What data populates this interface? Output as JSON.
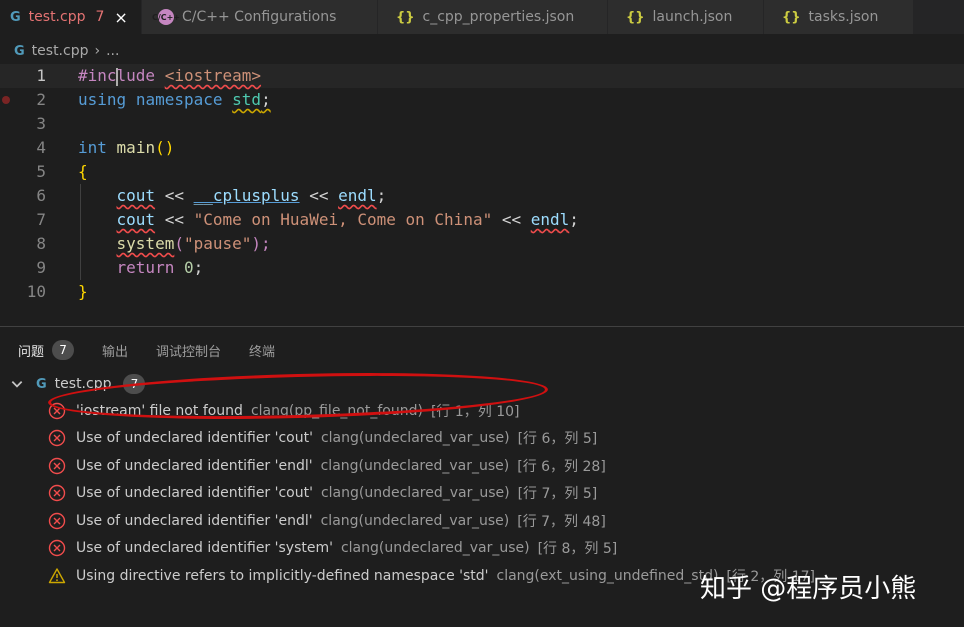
{
  "tabs": [
    {
      "label": "test.cpp",
      "icon": "cpp-file-icon",
      "badge": "7",
      "active": true
    },
    {
      "label": "C/C++ Configurations",
      "icon": "cpp-settings-icon",
      "active": false
    },
    {
      "label": "c_cpp_properties.json",
      "icon": "json-braces-icon",
      "active": false
    },
    {
      "label": "launch.json",
      "icon": "json-braces-icon",
      "active": false
    },
    {
      "label": "tasks.json",
      "icon": "json-braces-icon",
      "active": false
    }
  ],
  "icons": {
    "cpp": "G",
    "json": "{}",
    "gear": "C/C++",
    "close": "×",
    "chevron": "›",
    "ellipsis": "..."
  },
  "breadcrumb": {
    "file": "test.cpp",
    "more": "..."
  },
  "editor": {
    "line_numbers": [
      "1",
      "2",
      "3",
      "4",
      "5",
      "6",
      "7",
      "8",
      "9",
      "10"
    ],
    "lines": {
      "l1": {
        "a": "#inc",
        "b": "lude",
        "c": " ",
        "d": "<iostream>"
      },
      "l2": {
        "a": "using",
        "b": " ",
        "c": "namespace",
        "d": " ",
        "e": "std",
        ";": ";"
      },
      "l4": {
        "a": "int",
        "b": " ",
        "c": "main",
        "d": "()"
      },
      "l5": {
        "a": "{"
      },
      "l6": {
        "i": "    ",
        "a": "cout",
        "b": " << ",
        "c": "__cplusplus",
        "d": " << ",
        "e": "endl",
        "f": ";"
      },
      "l7": {
        "i": "    ",
        "a": "cout",
        "b": " << ",
        "c": "\"Come on HuaWei, Come on China\"",
        "d": " << ",
        "e": "endl",
        "f": ";"
      },
      "l8": {
        "i": "    ",
        "a": "system",
        "b": "(",
        "c": "\"pause\"",
        "d": ");"
      },
      "l9": {
        "i": "    ",
        "a": "return",
        "b": " ",
        "c": "0",
        "d": ";"
      },
      "l10": {
        "a": "}"
      }
    }
  },
  "panel": {
    "tabs": [
      {
        "label": "问题",
        "badge": "7"
      },
      {
        "label": "输出"
      },
      {
        "label": "调试控制台"
      },
      {
        "label": "终端"
      }
    ],
    "file": {
      "name": "test.cpp",
      "count": "7"
    },
    "problems": [
      {
        "severity": "error",
        "message": "'iostream' file not found",
        "source": "clang(pp_file_not_found)",
        "location": "[行 1，列 10]"
      },
      {
        "severity": "error",
        "message": "Use of undeclared identifier 'cout'",
        "source": "clang(undeclared_var_use)",
        "location": "[行 6，列 5]"
      },
      {
        "severity": "error",
        "message": "Use of undeclared identifier 'endl'",
        "source": "clang(undeclared_var_use)",
        "location": "[行 6，列 28]"
      },
      {
        "severity": "error",
        "message": "Use of undeclared identifier 'cout'",
        "source": "clang(undeclared_var_use)",
        "location": "[行 7，列 5]"
      },
      {
        "severity": "error",
        "message": "Use of undeclared identifier 'endl'",
        "source": "clang(undeclared_var_use)",
        "location": "[行 7，列 48]"
      },
      {
        "severity": "error",
        "message": "Use of undeclared identifier 'system'",
        "source": "clang(undeclared_var_use)",
        "location": "[行 8，列 5]"
      },
      {
        "severity": "warning",
        "message": "Using directive refers to implicitly-defined namespace 'std'",
        "source": "clang(ext_using_undefined_std)",
        "location": "[行 2，列 17]"
      }
    ]
  },
  "watermark": "知乎 @程序员小熊",
  "colors": {
    "error": "#f14c4c",
    "warning": "#cca700",
    "annotation": "#d01010"
  }
}
